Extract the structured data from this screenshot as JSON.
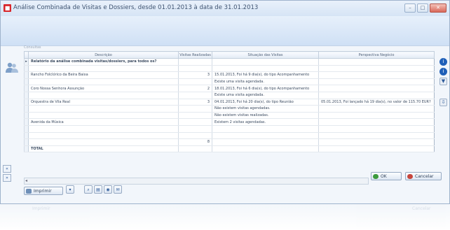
{
  "window": {
    "title": "Análise Combinada de Visitas e Dossiers, desde 01.01.2013 à data de 31.01.2013",
    "controls": [
      "–",
      "□",
      "✕"
    ]
  },
  "grid": {
    "caption": "Consultas",
    "headers": [
      "Descrição",
      "Visitas Realizadas",
      "Situação das Visitas",
      "Perspectiva Negócio"
    ],
    "rows": [
      {
        "sel": "▸",
        "desc": "Relatório da análise combinada visitas/dossiers, para todos os?",
        "count": "",
        "status": "",
        "persp": "",
        "bold": true
      },
      {
        "sel": "",
        "desc": "",
        "count": "",
        "status": "",
        "persp": ""
      },
      {
        "sel": "",
        "desc": "Rancho Folclórico da Beira Baixa",
        "count": "3",
        "status": "15.01.2013, Foi há 9 dia(s), do tipo Acompanhamento",
        "persp": ""
      },
      {
        "sel": "",
        "desc": "",
        "count": "",
        "status": "Existe uma visita agendada.",
        "persp": ""
      },
      {
        "sel": "",
        "desc": "Coro Nossa Senhora Assunção",
        "count": "2",
        "status": "18.01.2013, Foi há 6 dia(s), do tipo Acompanhamento",
        "persp": ""
      },
      {
        "sel": "",
        "desc": "",
        "count": "",
        "status": "Existe uma visita agendada.",
        "persp": ""
      },
      {
        "sel": "",
        "desc": "Orquestra de Vila Real",
        "count": "3",
        "status": "04.01.2013, Foi há 20 dia(s), do tipo Reunião",
        "persp": "05.01.2013, Foi lançado há 19 dia(s), no valor de 115.70 EUR?"
      },
      {
        "sel": "",
        "desc": "",
        "count": "",
        "status": "Não existem visitas agendadas.",
        "persp": ""
      },
      {
        "sel": "",
        "desc": "",
        "count": "",
        "status": "Não existem visitas realizadas.",
        "persp": ""
      },
      {
        "sel": "",
        "desc": "Avenida da Música",
        "count": "",
        "status": "Existem 2 visitas agendadas.",
        "persp": ""
      },
      {
        "sel": "",
        "desc": "",
        "count": "",
        "status": "",
        "persp": ""
      },
      {
        "sel": "",
        "desc": "",
        "count": "",
        "status": "",
        "persp": ""
      },
      {
        "sel": "",
        "desc": "",
        "count": "8",
        "status": "",
        "persp": ""
      },
      {
        "sel": "",
        "desc": "TOTAL",
        "count": "",
        "status": "",
        "persp": "",
        "bold": true
      }
    ]
  },
  "buttons": {
    "print": "Imprimir",
    "ok": "OK",
    "cancel": "Cancelar"
  },
  "reflection": {
    "print": "Imprimir",
    "cancel": "Cancelar"
  },
  "colors": {
    "accent": "#1f5fb8",
    "titlebar": "#d6e4f5",
    "close": "#d9685a"
  }
}
